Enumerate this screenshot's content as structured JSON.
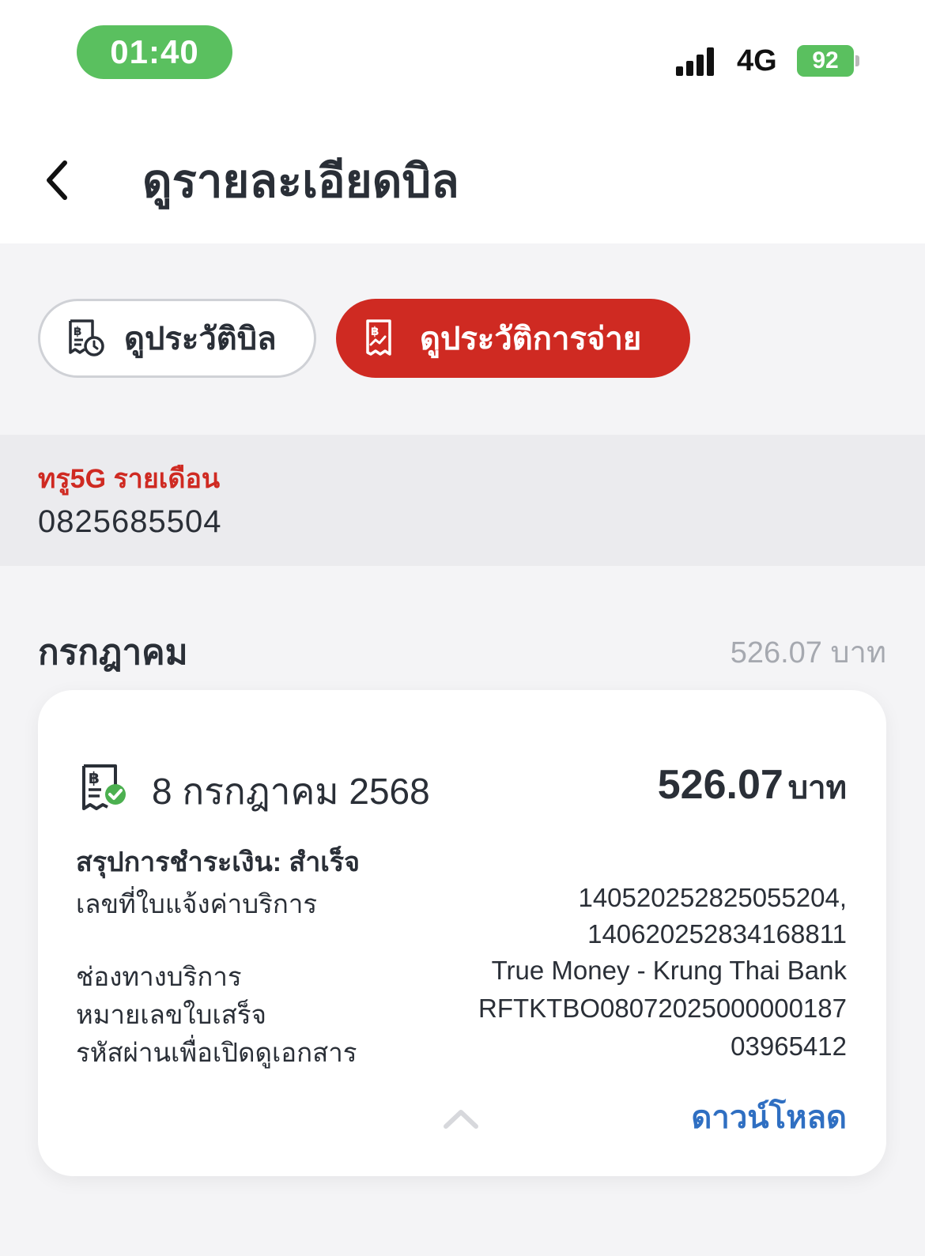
{
  "status_bar": {
    "time": "01:40",
    "network": "4G",
    "battery": "92"
  },
  "header": {
    "title": "ดูรายละเอียดบิล"
  },
  "tabs": {
    "bill_history": "ดูประวัติบิล",
    "payment_history": "ดูประวัติการจ่าย"
  },
  "account": {
    "plan": "ทรู5G รายเดือน",
    "number": "0825685504"
  },
  "month": {
    "name": "กรกฎาคม",
    "total": "526.07 บาท"
  },
  "payment": {
    "date": "8 กรกฎาคม 2568",
    "amount": "526.07",
    "amount_unit": "บาท",
    "summary": "สรุปการชำระเงิน: สำเร็จ",
    "details": [
      {
        "label": "เลขที่ใบแจ้งค่าบริการ",
        "value": "140520252825055204,\n140620252834168811"
      },
      {
        "label": "ช่องทางบริการ",
        "value": "True Money - Krung Thai Bank"
      },
      {
        "label": "หมายเลขใบเสร็จ",
        "value": "RFTKTBO080720250000001​87"
      },
      {
        "label": "รหัสผ่านเพื่อเปิดดูเอกสาร",
        "value": "03965412"
      }
    ],
    "download_label": "ดาวน์โหลด"
  },
  "colors": {
    "accent_red": "#cf2a22",
    "link_blue": "#2f6fc2",
    "status_green": "#5ac05f"
  }
}
